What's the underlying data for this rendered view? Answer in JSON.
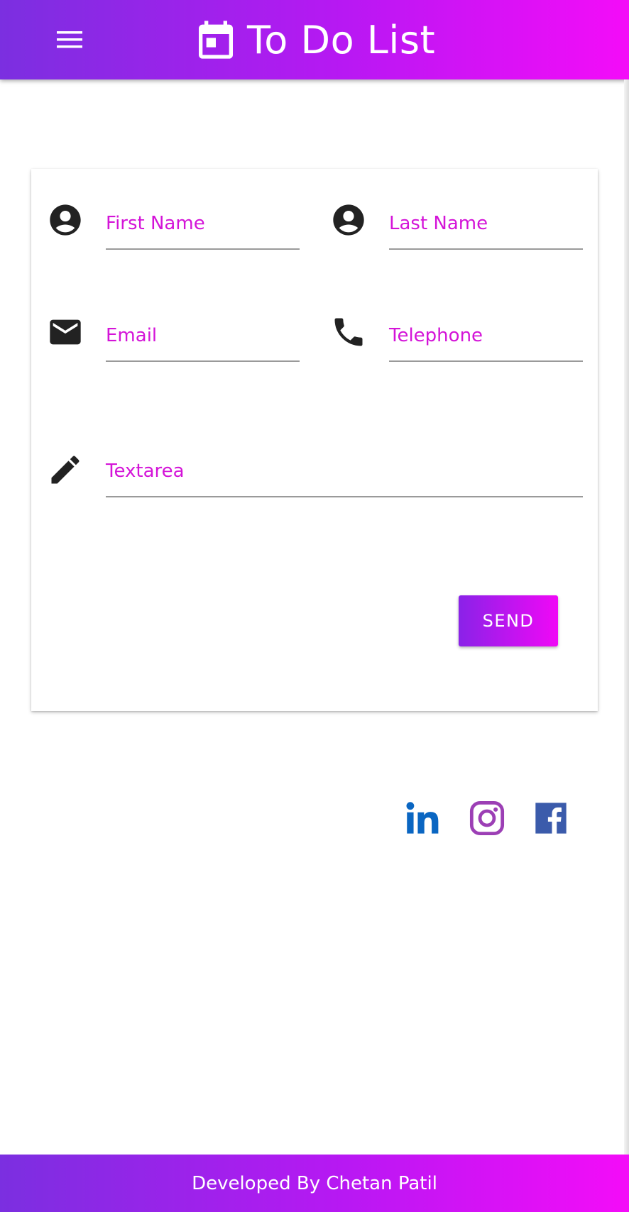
{
  "app": {
    "title": "To Do List"
  },
  "header": {
    "menu_icon": "menu-icon",
    "logo_icon": "calendar-today-icon"
  },
  "form": {
    "first_name": {
      "label": "First Name",
      "icon": "account-circle-icon"
    },
    "last_name": {
      "label": "Last Name",
      "icon": "account-circle-icon"
    },
    "email": {
      "label": "Email",
      "icon": "email-icon"
    },
    "telephone": {
      "label": "Telephone",
      "icon": "phone-icon"
    },
    "textarea": {
      "label": "Textarea",
      "icon": "pencil-icon"
    },
    "send_label": "SEND"
  },
  "social": [
    {
      "icon": "linkedin-icon",
      "color": "#0a66c2"
    },
    {
      "icon": "instagram-icon",
      "color": "#9c3fb5"
    },
    {
      "icon": "facebook-icon",
      "color": "#3b5bab"
    }
  ],
  "footer": {
    "credit": "Developed By Chetan Patil"
  },
  "colors": {
    "gradient_start": "#7b2fe0",
    "gradient_end": "#f40cf8",
    "label_accent": "#d414d8"
  }
}
